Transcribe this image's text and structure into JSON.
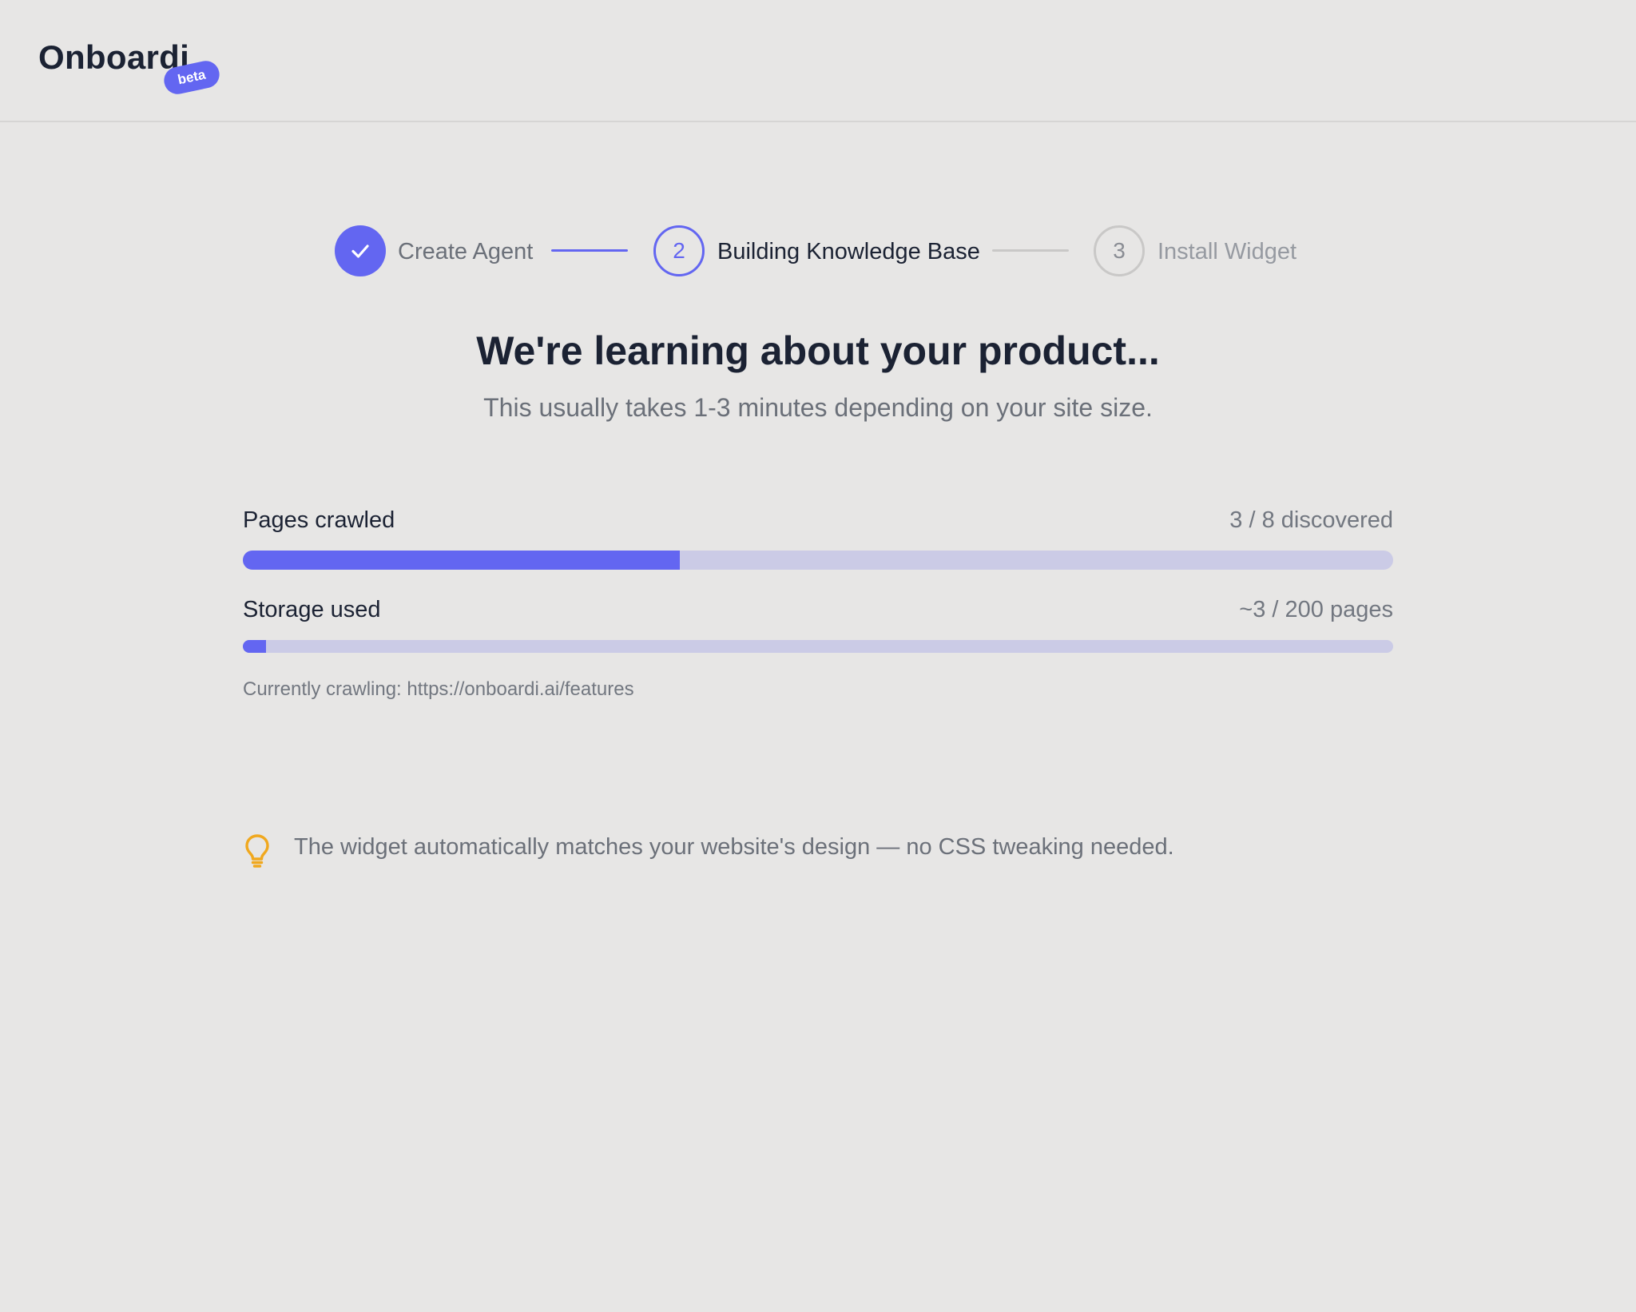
{
  "app": {
    "name": "Onboardi",
    "badge": "beta"
  },
  "stepper": {
    "steps": [
      {
        "number": "1",
        "label": "Create Agent",
        "state": "done"
      },
      {
        "number": "2",
        "label": "Building Knowledge Base",
        "state": "active"
      },
      {
        "number": "3",
        "label": "Install Widget",
        "state": "pending"
      }
    ]
  },
  "main": {
    "title": "We're learning about your product...",
    "subtitle": "This usually takes 1-3 minutes depending on your site size."
  },
  "metrics": {
    "pages": {
      "label": "Pages crawled",
      "value_text": "3 / 8 discovered",
      "progress": 0.38
    },
    "storage": {
      "label": "Storage used",
      "value_text": "~3 / 200 pages",
      "progress": 0.02
    }
  },
  "crawling": {
    "text": "Currently crawling: https://onboardi.ai/features"
  },
  "tip": {
    "icon": "lightbulb-icon",
    "text": "The widget automatically matches your website's design — no CSS tweaking needed."
  },
  "colors": {
    "accent": "#6366f1",
    "track": "#cbcbe6",
    "background": "#e7e6e5",
    "tip_icon": "#f0a81e"
  }
}
